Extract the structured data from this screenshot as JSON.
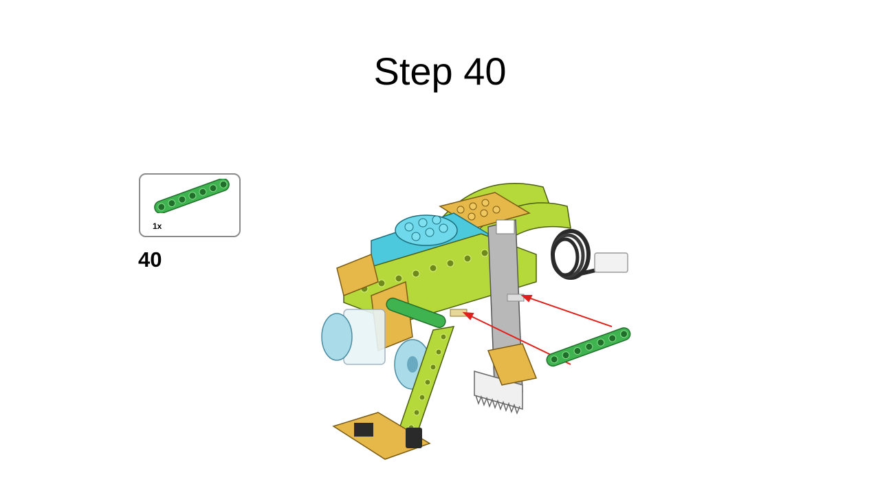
{
  "slide": {
    "title": "Step 40"
  },
  "parts_callout": {
    "parts": [
      {
        "name": "green-beam-7-icon",
        "quantity_label": "1x",
        "color": "#3fb34f"
      }
    ],
    "border_color": "#8a8a8a"
  },
  "step": {
    "number": "40"
  },
  "model": {
    "icon": "lego-walking-robot-model-icon",
    "new_part_icon": "green-beam-7-icon",
    "arrow_color": "#e0201b",
    "colors": {
      "lime": "#b5d83a",
      "green": "#3fb34f",
      "tan": "#e6b84a",
      "azure": "#4dc9de",
      "gray": "#a8a8a8",
      "black": "#2a2a2a"
    }
  }
}
